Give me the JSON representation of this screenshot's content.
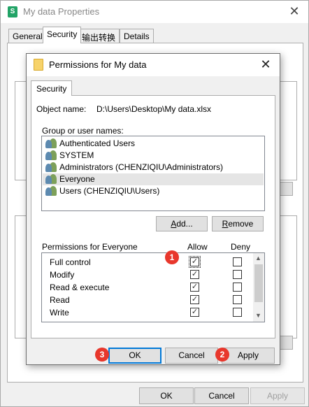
{
  "outer_window": {
    "title": "My data Properties",
    "app_icon": "excel-icon",
    "close_glyph": "✕",
    "tabs": [
      {
        "label": "General"
      },
      {
        "label": "Security"
      },
      {
        "label": "输出转换"
      },
      {
        "label": "Details"
      }
    ],
    "buttons": {
      "ok": "OK",
      "cancel": "Cancel",
      "apply": "Apply"
    }
  },
  "dialog": {
    "title": "Permissions for My data",
    "folder_icon": "folder-icon",
    "close_glyph": "✕",
    "tab": "Security",
    "object_name_label": "Object name:",
    "object_name_value": "D:\\Users\\Desktop\\My data.xlsx",
    "group_label": "Group or user names:",
    "users": [
      {
        "name": "Authenticated Users",
        "selected": false
      },
      {
        "name": "SYSTEM",
        "selected": false
      },
      {
        "name": "Administrators (CHENZIQIU\\Administrators)",
        "selected": false
      },
      {
        "name": "Everyone",
        "selected": true
      },
      {
        "name": "Users (CHENZIQIU\\Users)",
        "selected": false
      }
    ],
    "add_button": {
      "pre": "",
      "key": "A",
      "post": "dd..."
    },
    "remove_button": {
      "pre": "",
      "key": "R",
      "post": "emove"
    },
    "permissions_label": "Permissions for Everyone",
    "allow_label": "Allow",
    "deny_label": "Deny",
    "permissions": [
      {
        "name": "Full control",
        "allow": true,
        "deny": false
      },
      {
        "name": "Modify",
        "allow": true,
        "deny": false
      },
      {
        "name": "Read & execute",
        "allow": true,
        "deny": false
      },
      {
        "name": "Read",
        "allow": true,
        "deny": false
      },
      {
        "name": "Write",
        "allow": true,
        "deny": false
      }
    ],
    "buttons": {
      "ok": "OK",
      "cancel": "Cancel",
      "apply": "Apply"
    }
  },
  "markers": [
    "1",
    "2",
    "3"
  ],
  "colors": {
    "marker": "#e8372c",
    "default_button_border": "#0078d7",
    "selection": "#e5e5e5"
  }
}
